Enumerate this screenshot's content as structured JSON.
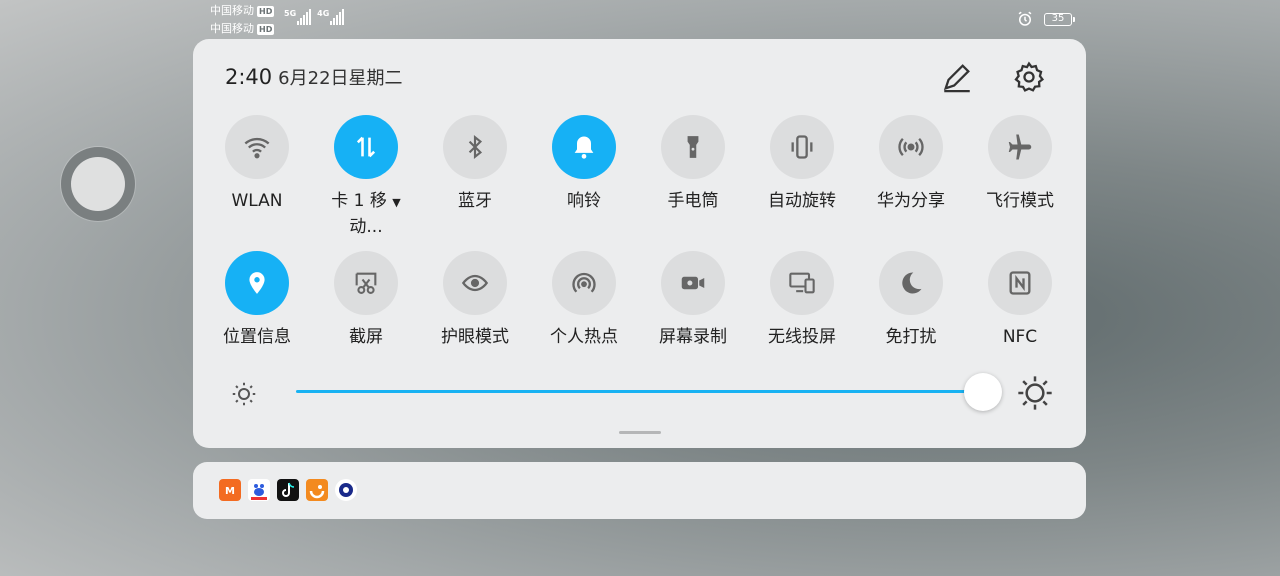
{
  "status_bar": {
    "carrier1": "中国移动",
    "carrier2": "中国移动",
    "hd_badge": "HD",
    "net1": "5G",
    "net2": "4G",
    "battery": "35"
  },
  "panel": {
    "time": "2:40",
    "date": "6月22日星期二",
    "edit_icon": "pencil-icon",
    "settings_icon": "gear-icon",
    "tiles_row1": [
      {
        "label": "WLAN",
        "icon": "wifi-icon",
        "active": false
      },
      {
        "label": "卡 1 移",
        "label2": "动...",
        "icon": "mobile-data-icon",
        "active": true
      },
      {
        "label": "蓝牙",
        "icon": "bluetooth-icon",
        "active": false
      },
      {
        "label": "响铃",
        "icon": "bell-icon",
        "active": true
      },
      {
        "label": "手电筒",
        "icon": "flashlight-icon",
        "active": false
      },
      {
        "label": "自动旋转",
        "icon": "rotate-icon",
        "active": false
      },
      {
        "label": "华为分享",
        "icon": "share-icon",
        "active": false
      },
      {
        "label": "飞行模式",
        "icon": "airplane-icon",
        "active": false
      }
    ],
    "tiles_row2": [
      {
        "label": "位置信息",
        "icon": "location-icon",
        "active": true
      },
      {
        "label": "截屏",
        "icon": "screenshot-icon",
        "active": false
      },
      {
        "label": "护眼模式",
        "icon": "eye-icon",
        "active": false
      },
      {
        "label": "个人热点",
        "icon": "hotspot-icon",
        "active": false
      },
      {
        "label": "屏幕录制",
        "icon": "video-icon",
        "active": false
      },
      {
        "label": "无线投屏",
        "icon": "cast-icon",
        "active": false
      },
      {
        "label": "免打扰",
        "icon": "moon-icon",
        "active": false
      },
      {
        "label": "NFC",
        "icon": "nfc-icon",
        "active": false
      }
    ],
    "brightness": {
      "value": 1.0,
      "min_icon": "sun-small-icon",
      "max_icon": "sun-large-icon",
      "color": "#18b2f2"
    }
  },
  "notifications": {
    "apps": [
      "mgtv-icon",
      "baidu-icon",
      "tiktok-icon",
      "uc-browser-icon",
      "chat-app-icon"
    ]
  },
  "colors": {
    "accent": "#16b1f5",
    "tile_off": "#dcddde",
    "panel_bg": "#ecedee"
  }
}
